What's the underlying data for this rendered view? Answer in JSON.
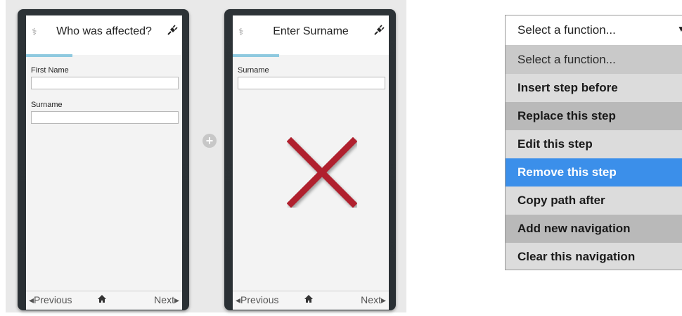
{
  "phone_left": {
    "title": "Who was affected?",
    "fields": [
      {
        "label": "First Name",
        "value": ""
      },
      {
        "label": "Surname",
        "value": ""
      }
    ],
    "nav": {
      "previous": "◂Previous",
      "next": "Next▸"
    },
    "icons": {
      "left": "caduceus-icon",
      "right": "plug-icon",
      "home": "home-icon"
    }
  },
  "phone_right": {
    "title": "Enter Surname",
    "fields": [
      {
        "label": "Surname",
        "value": ""
      }
    ],
    "nav": {
      "previous": "◂Previous",
      "next": "Next▸"
    },
    "overlay": "remove-x-mark",
    "icons": {
      "left": "caduceus-icon",
      "right": "plug-icon",
      "home": "home-icon"
    }
  },
  "add_icon": "plus-circle-icon",
  "function_dropdown": {
    "selected": "Select a function...",
    "options": [
      "Select a function...",
      "Insert step before",
      "Replace this step",
      "Edit this step",
      "Remove this step",
      "Copy path after",
      "Add new navigation",
      "Clear this navigation"
    ],
    "highlighted": "Remove this step"
  },
  "colors": {
    "phone_frame": "#2c3236",
    "progress": "#8ec9df",
    "highlight": "#3b8fea",
    "x_mark": "#b0202e"
  }
}
